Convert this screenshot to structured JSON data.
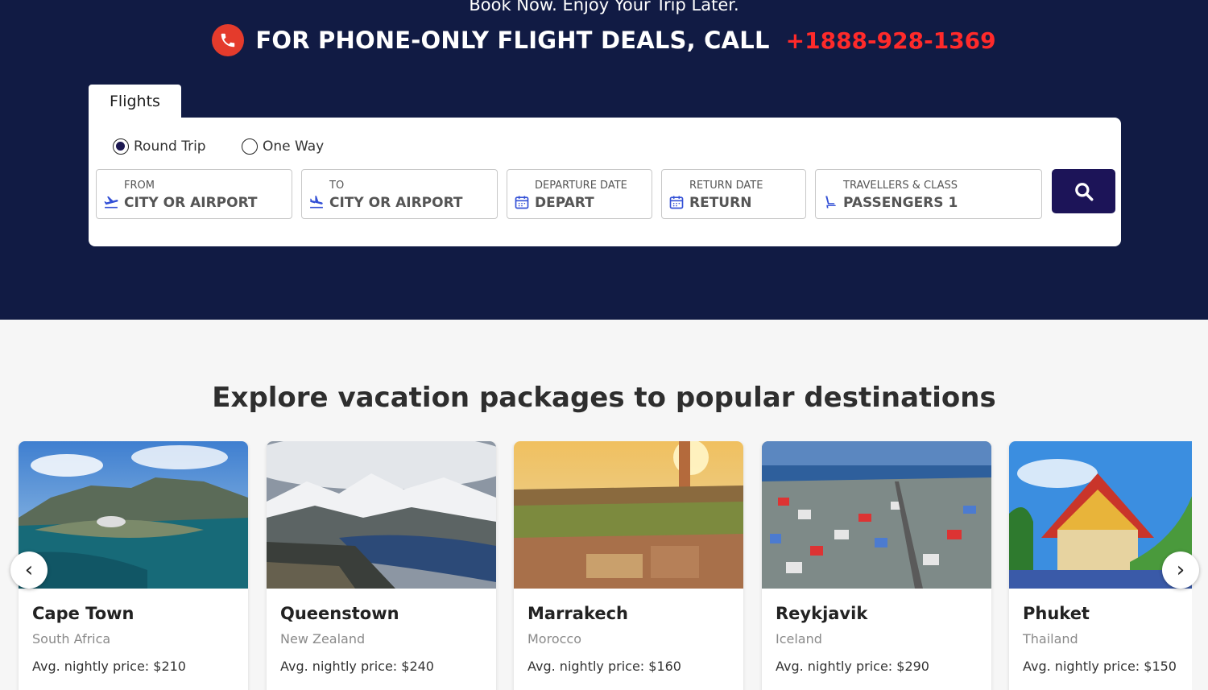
{
  "hero": {
    "tagline": "Book Now. Enjoy Your Trip Later.",
    "phone_text": "FOR PHONE-ONLY FLIGHT DEALS, CALL",
    "phone_number": "+1888-928-1369"
  },
  "search": {
    "tab_label": "Flights",
    "trip_types": [
      {
        "label": "Round Trip",
        "selected": true
      },
      {
        "label": "One Way",
        "selected": false
      }
    ],
    "fields": [
      {
        "label": "FROM",
        "value": "CITY OR AIRPORT",
        "icon": "plane-takeoff-icon"
      },
      {
        "label": "TO",
        "value": "CITY OR AIRPORT",
        "icon": "plane-landing-icon"
      },
      {
        "label": "DEPARTURE DATE",
        "value": "DEPART",
        "icon": "calendar-icon"
      },
      {
        "label": "RETURN DATE",
        "value": "RETURN",
        "icon": "calendar-icon"
      },
      {
        "label": "TRAVELLERS & CLASS",
        "value": "PASSENGERS 1",
        "icon": "seat-icon"
      }
    ],
    "search_icon": "search-icon"
  },
  "destinations": {
    "title": "Explore vacation packages to popular destinations",
    "cards": [
      {
        "name": "Cape Town",
        "country": "South Africa",
        "price": "Avg. nightly price: $210"
      },
      {
        "name": "Queenstown",
        "country": "New Zealand",
        "price": "Avg. nightly price: $240"
      },
      {
        "name": "Marrakech",
        "country": "Morocco",
        "price": "Avg. nightly price: $160"
      },
      {
        "name": "Reykjavik",
        "country": "Iceland",
        "price": "Avg. nightly price: $290"
      },
      {
        "name": "Phuket",
        "country": "Thailand",
        "price": "Avg. nightly price: $150"
      }
    ],
    "prev_arrow": "‹",
    "next_arrow": "›"
  },
  "colors": {
    "hero_bg": "#111b44",
    "accent_red": "#ff2a2a",
    "search_button": "#1c1458"
  }
}
